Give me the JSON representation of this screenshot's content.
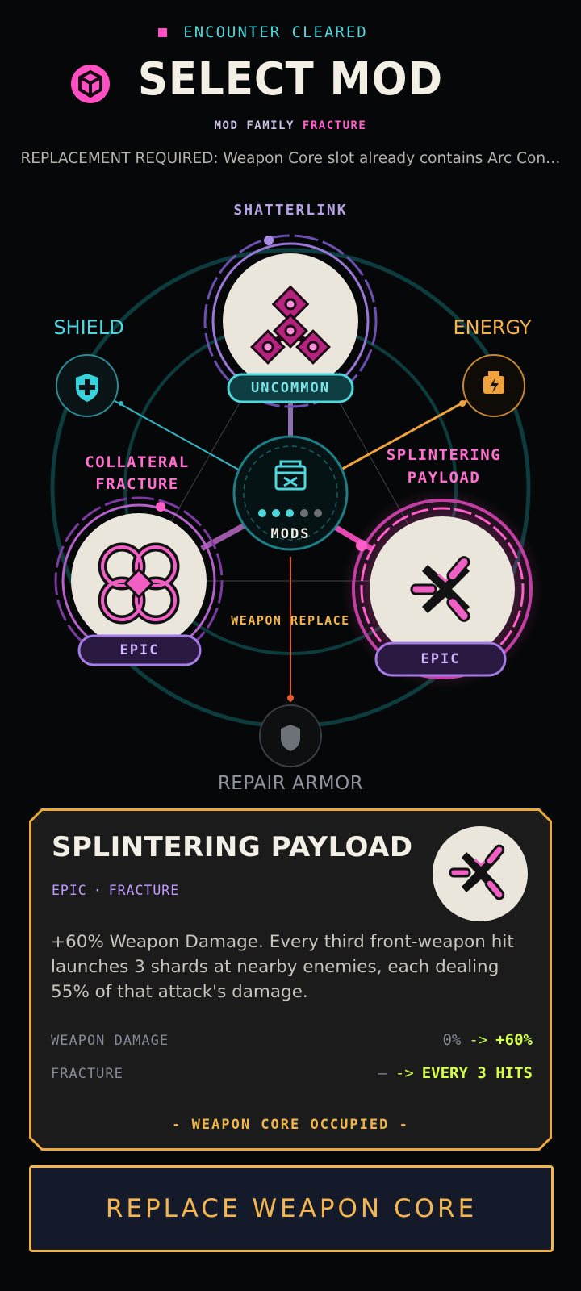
{
  "header": {
    "status": "ENCOUNTER CLEARED",
    "title": "SELECT MOD",
    "family_key": "MOD FAMILY",
    "family_value": "FRACTURE",
    "replacement_message": "REPLACEMENT REQUIRED: Weapon Core slot already contains Arc Con…"
  },
  "map": {
    "hub_label": "MODS",
    "weapon_label": "WEAPON REPLACE",
    "slots": {
      "shield": "SHIELD",
      "energy": "ENERGY",
      "repair": "REPAIR ARMOR"
    },
    "mods": [
      {
        "name": "SHATTERLINK",
        "rarity": "UNCOMMON"
      },
      {
        "name_line1": "COLLATERAL",
        "name_line2": "FRACTURE",
        "rarity": "EPIC"
      },
      {
        "name_line1": "SPLINTERING",
        "name_line2": "PAYLOAD",
        "rarity": "EPIC"
      }
    ]
  },
  "detail": {
    "title": "SPLINTERING PAYLOAD",
    "rarity": "EPIC",
    "separator": "·",
    "family": "FRACTURE",
    "description": "+60% Weapon Damage. Every third front-weapon hit launches 3 shards at nearby enemies, each dealing 55% of that attack's damage.",
    "stats": [
      {
        "label": "WEAPON DAMAGE",
        "from": "0%",
        "arrow": "->",
        "to": "+60%"
      },
      {
        "label": "FRACTURE",
        "from": "—",
        "arrow": "->",
        "to": "EVERY 3 HITS"
      }
    ],
    "occupied": "- WEAPON CORE OCCUPIED -"
  },
  "cta": {
    "label": "REPLACE WEAPON CORE"
  },
  "colors": {
    "accent_pink": "#ff4fc3",
    "accent_cyan": "#4fd7dc",
    "accent_gold": "#f0b54b",
    "accent_lime": "#d6ff4a",
    "rarity_epic": "#c39bff"
  }
}
